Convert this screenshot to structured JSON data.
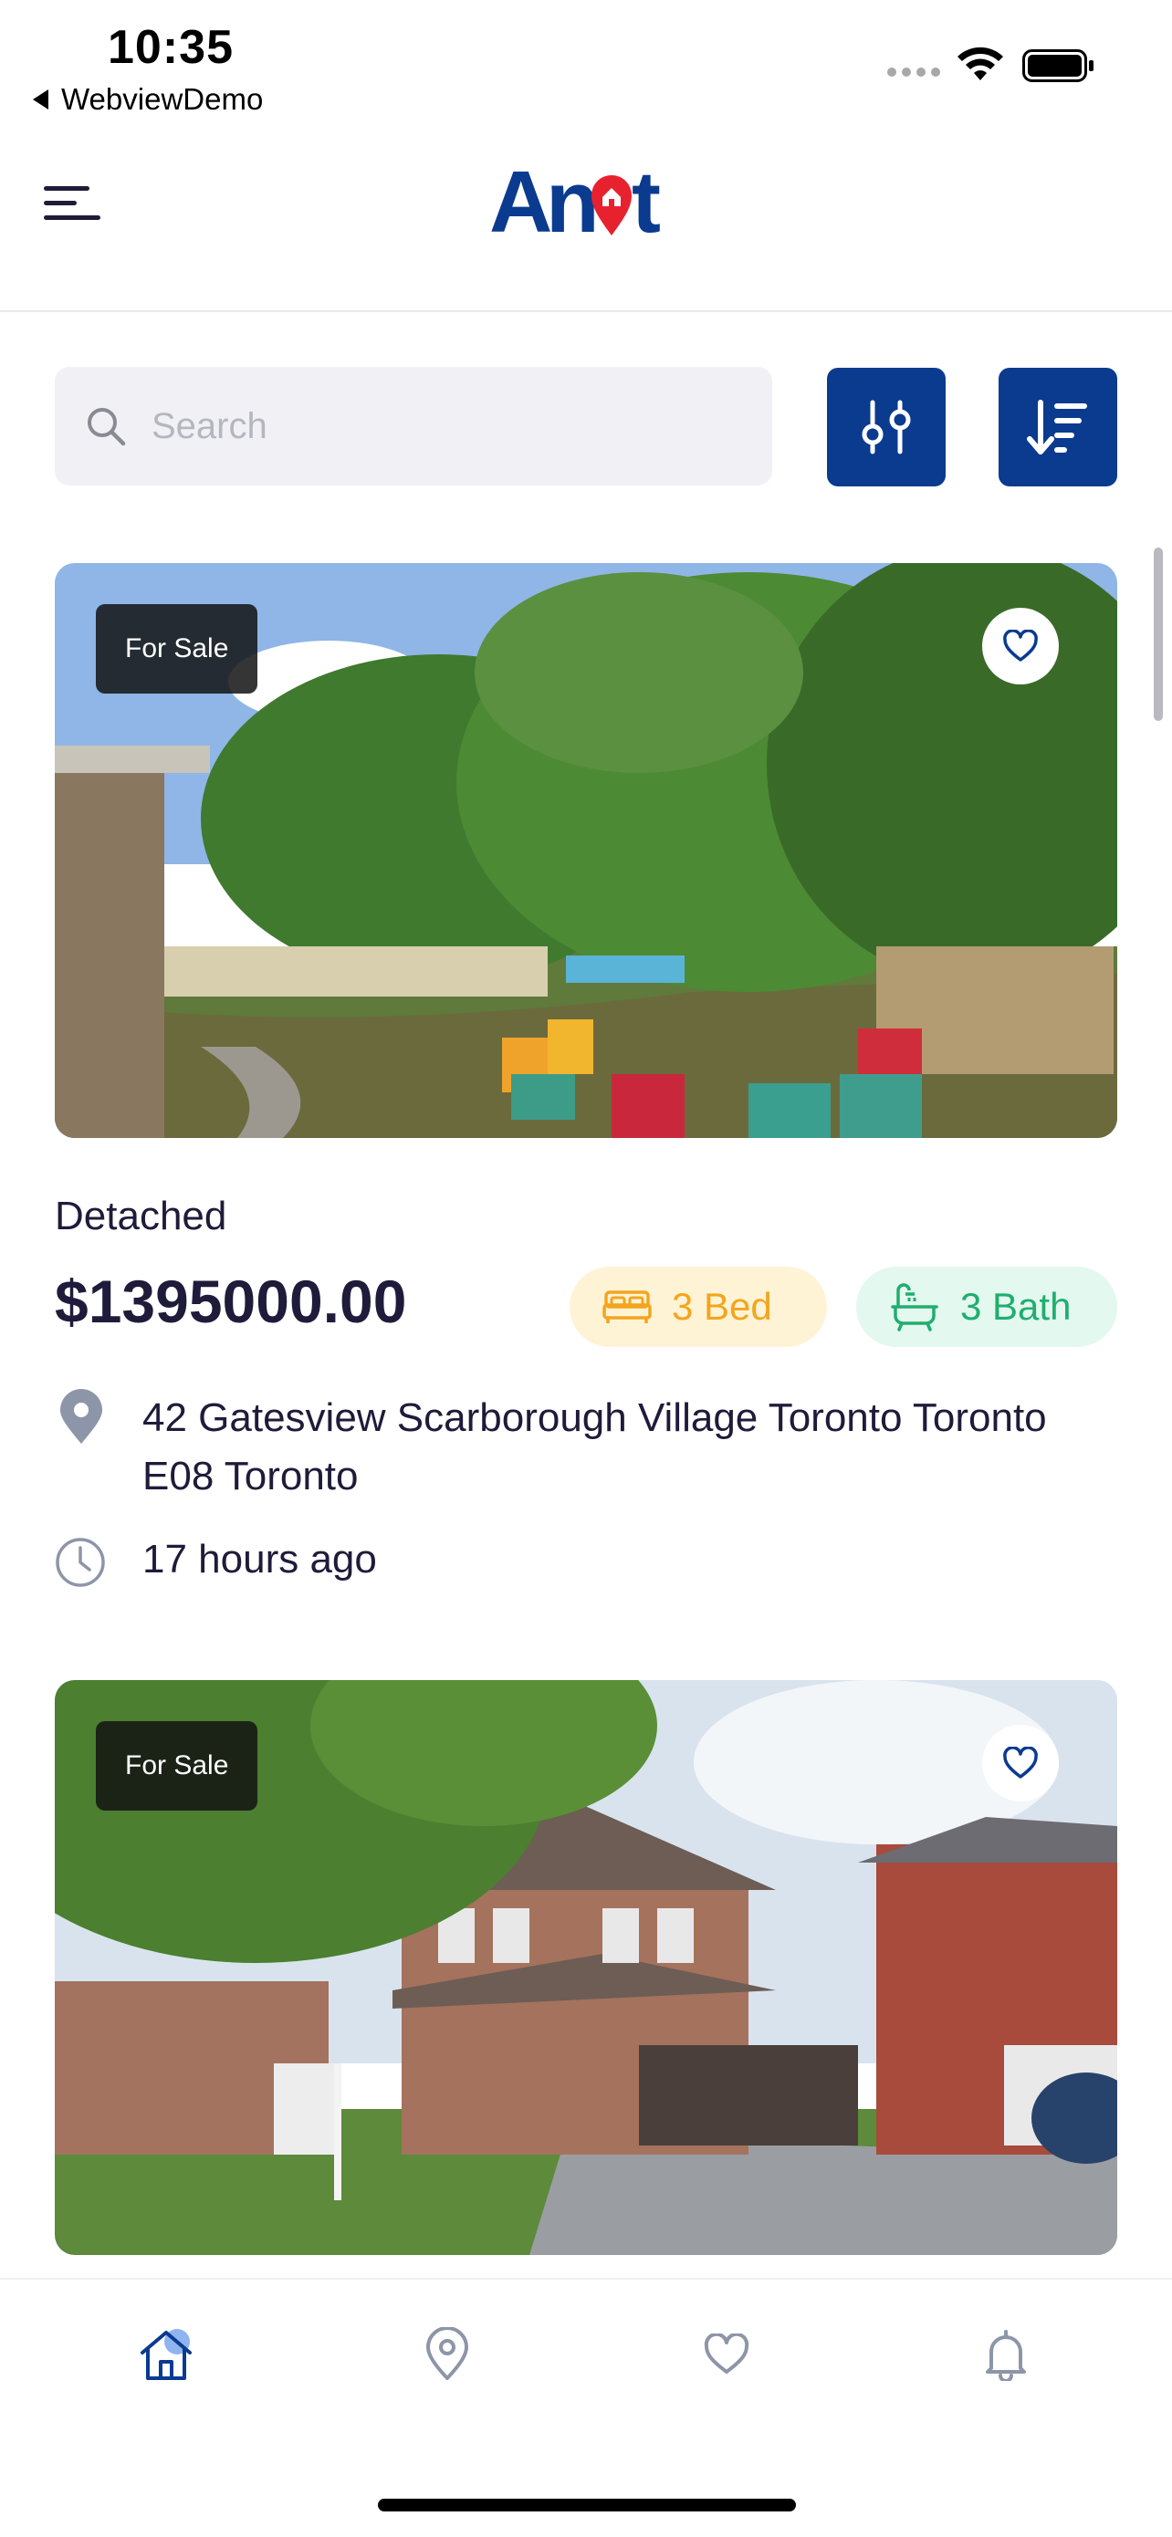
{
  "status_bar": {
    "time": "10:35",
    "back_app": "WebviewDemo"
  },
  "header": {
    "logo_text": "Anot",
    "menu_icon": "hamburger-menu-icon"
  },
  "search": {
    "placeholder": "Search",
    "value": ""
  },
  "toolbar": {
    "filter_icon": "sliders-icon",
    "sort_icon": "sort-descending-icon"
  },
  "colors": {
    "brand": "#0a3b8f",
    "bed": "#f3a51d",
    "bath": "#1fae6e",
    "logo_red": "#e8212f"
  },
  "listings": [
    {
      "badge": "For Sale",
      "type": "Detached",
      "price": "$1395000.00",
      "beds": "3 Bed",
      "baths": "3 Bath",
      "address": "42 Gatesview Scarborough Village Toronto Toronto E08 Toronto",
      "time_ago": "17 hours ago"
    },
    {
      "badge": "For Sale"
    }
  ],
  "nav": [
    {
      "icon": "home-icon",
      "active": true
    },
    {
      "icon": "map-pin-icon",
      "active": false
    },
    {
      "icon": "heart-icon",
      "active": false
    },
    {
      "icon": "bell-icon",
      "active": false
    }
  ]
}
